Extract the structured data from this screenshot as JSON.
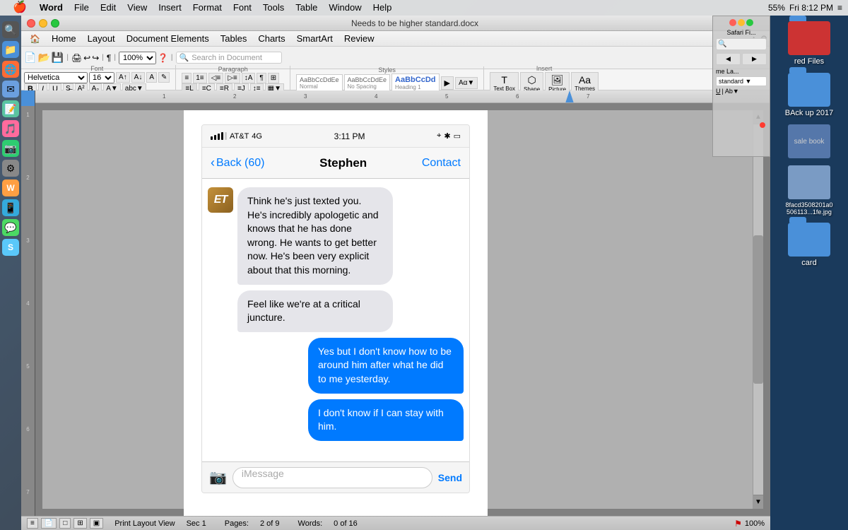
{
  "menu_bar": {
    "apple": "🍎",
    "items": [
      "Word",
      "File",
      "Edit",
      "View",
      "Insert",
      "Format",
      "Font",
      "Tools",
      "Table",
      "Window",
      "Help"
    ],
    "right": {
      "battery": "55%",
      "time": "Fri 8:12 PM",
      "wifi": "▼"
    }
  },
  "title_bar": {
    "title": "Needs to be higher standard.docx"
  },
  "word_menu": {
    "items": [
      "Home",
      "Layout",
      "Document Elements",
      "Tables",
      "Charts",
      "SmartArt",
      "Review"
    ]
  },
  "toolbar": {
    "font": "Helvetica",
    "size": "16",
    "zoom": "100%"
  },
  "ribbon": {
    "active_tab": "Home",
    "styles": [
      "AaBbCcDdEe",
      "AaBbCcDdEe",
      "AaBbCcDd"
    ],
    "style_names": [
      "Normal",
      "No Spacing",
      "Heading 1"
    ],
    "insert_items": [
      "Text Box",
      "Shape",
      "Picture",
      "Themes"
    ]
  },
  "status_bar": {
    "view": "Print Layout View",
    "section": "Sec 1",
    "pages_label": "Pages:",
    "pages": "2 of 9",
    "words_label": "Words:",
    "words": "0 of 16",
    "zoom": "100%"
  },
  "desktop": {
    "folders": [
      {
        "label": "red Files",
        "color": "#e05555"
      },
      {
        "label": "BAck up 2017",
        "color": "#4a90d9"
      },
      {
        "label": "sale book",
        "color": "#4a90d9"
      },
      {
        "label": "8facd3508201a0 506113...1fe.jpg",
        "color": "#5588cc"
      },
      {
        "label": "card",
        "color": "#4a90d9"
      }
    ]
  },
  "iphone": {
    "status_bar": {
      "carrier": "AT&T",
      "network": "4G",
      "time": "3:11 PM",
      "battery": "🔋"
    },
    "nav": {
      "back_label": "Back (60)",
      "contact_name": "Stephen",
      "contact_link": "Contact"
    },
    "messages": [
      {
        "type": "incoming",
        "has_avatar": true,
        "avatar_text": "ET",
        "text": "Think he's just texted you. He's incredibly apologetic and knows that he has done wrong. He wants to get better now. He's been very explicit about that this morning."
      },
      {
        "type": "incoming",
        "has_avatar": false,
        "text": "Feel like we're at a critical juncture."
      },
      {
        "type": "outgoing",
        "text": "Yes but I don't know how to be around him after what he did to me yesterday."
      },
      {
        "type": "outgoing",
        "text": "I don't know if I can stay with him."
      }
    ],
    "input": {
      "placeholder": "iMessage",
      "send_label": "Send"
    }
  },
  "dock": {
    "icons": [
      "🔍",
      "📁",
      "🌐",
      "✉",
      "📝",
      "🎵",
      "📷",
      "⚙",
      "🛒",
      "📱",
      "💬",
      "S"
    ]
  }
}
